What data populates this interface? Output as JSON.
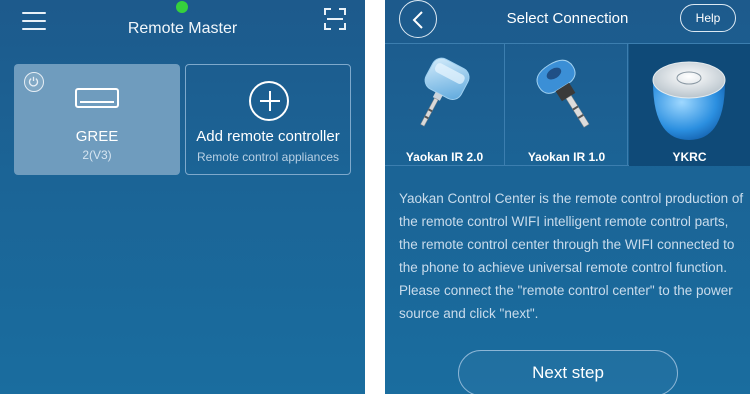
{
  "left_screen": {
    "title": "Remote Master",
    "device_card": {
      "name": "GREE",
      "subtitle": "2(V3)"
    },
    "add_card": {
      "label": "Add remote controller",
      "subtitle": "Remote control appliances"
    }
  },
  "right_screen": {
    "title": "Select Connection",
    "help_label": "Help",
    "devices": [
      {
        "label": "Yaokan IR 2.0"
      },
      {
        "label": "Yaokan IR 1.0"
      },
      {
        "label": "YKRC",
        "selected": true
      }
    ],
    "description": "Yaokan Control Center is the remote control production of the remote control WIFI intelligent remote control parts, the remote control center through the WIFI connected to the phone to achieve universal remote control function. Please connect the \"remote control center\" to the power source and click \"next\".",
    "next_button": "Next step"
  },
  "colors": {
    "background_top": "#1d5a8c",
    "background_bottom": "#1a6d9f",
    "device_card": "#6f9cbe",
    "status_dot": "#36d13c",
    "selected_option": "#0f4a78"
  }
}
